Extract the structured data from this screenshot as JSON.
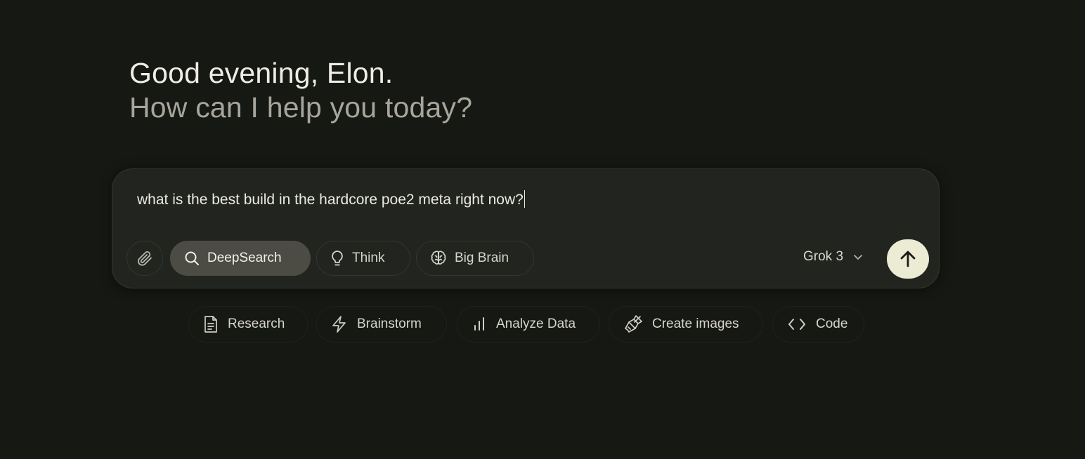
{
  "greeting": {
    "line1": "Good evening, Elon.",
    "line2": "How can I help you today?"
  },
  "composer": {
    "input_value": "what is the best build in the hardcore poe2 meta right now?",
    "attach_icon": "paperclip-icon",
    "modes": [
      {
        "label": "DeepSearch",
        "icon": "search-icon",
        "active": true
      },
      {
        "label": "Think",
        "icon": "lightbulb-icon",
        "active": false
      },
      {
        "label": "Big Brain",
        "icon": "brain-icon",
        "active": false
      }
    ],
    "model": {
      "label": "Grok 3",
      "icon": "chevron-down-icon"
    },
    "send_icon": "arrow-up-icon"
  },
  "suggestions": [
    {
      "label": "Research",
      "icon": "document-icon"
    },
    {
      "label": "Brainstorm",
      "icon": "lightning-icon"
    },
    {
      "label": "Analyze Data",
      "icon": "bar-chart-icon"
    },
    {
      "label": "Create images",
      "icon": "paintbrush-icon"
    },
    {
      "label": "Code",
      "icon": "code-icon"
    }
  ],
  "colors": {
    "background": "#161813",
    "composer": "#22241f",
    "active_pill": "#4c4c44",
    "send_button": "#ecebd3"
  }
}
